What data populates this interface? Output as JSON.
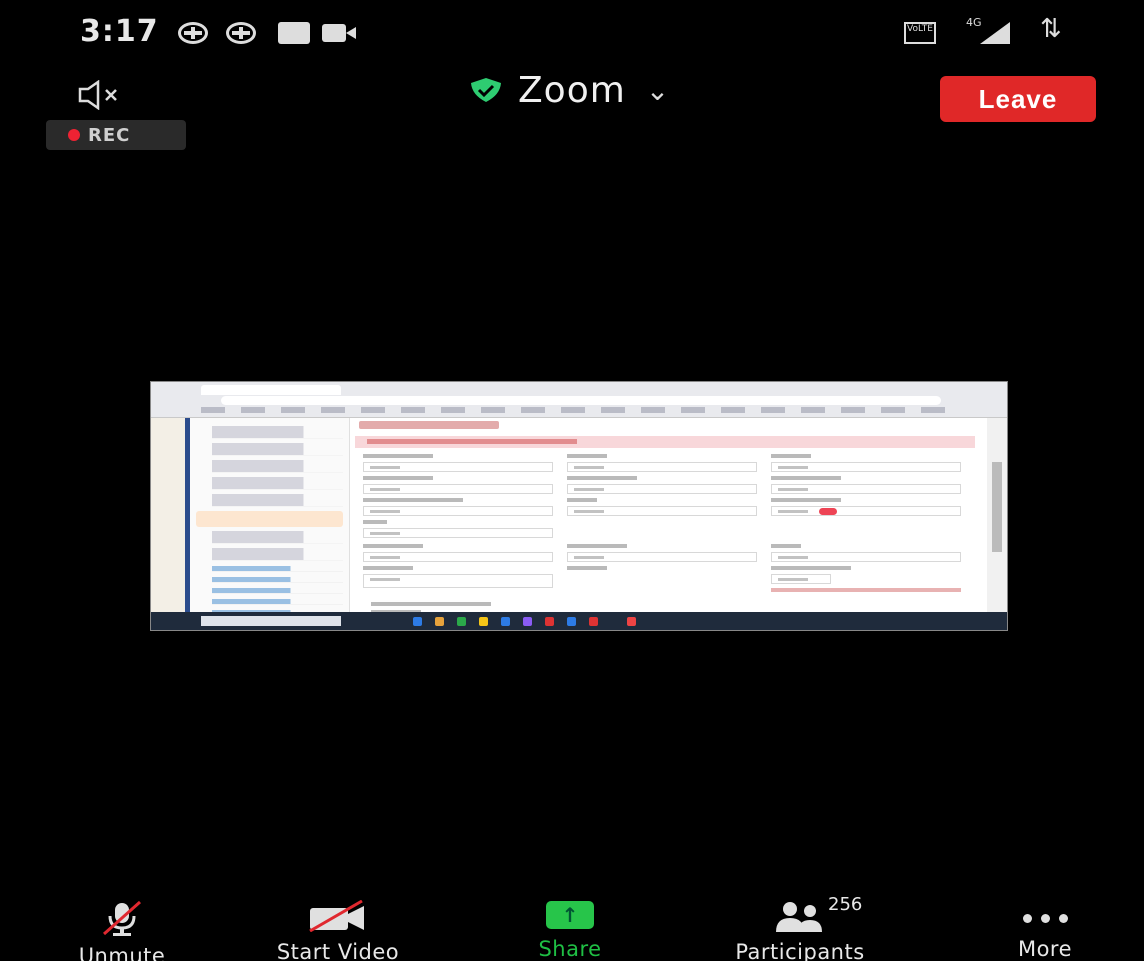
{
  "status_bar": {
    "time": "3:17",
    "network": "4G",
    "volte": "VoLTE"
  },
  "top_bar": {
    "speaker_icon": "speaker-muted-icon",
    "meeting_title": "Zoom",
    "leave_label": "Leave",
    "recording_label": "REC"
  },
  "shared_screen": {
    "description_icon": "shared-content-browser-window"
  },
  "toolbar": {
    "unmute_label": "Unmute",
    "start_video_label": "Start Video",
    "share_label": "Share",
    "participants_label": "Participants",
    "participants_count": "256",
    "more_label": "More"
  },
  "colors": {
    "leave": "#e02828",
    "share_accent": "#27c54a",
    "shield": "#2ecc71",
    "rec_dot": "#ee2233",
    "background": "#000000"
  }
}
